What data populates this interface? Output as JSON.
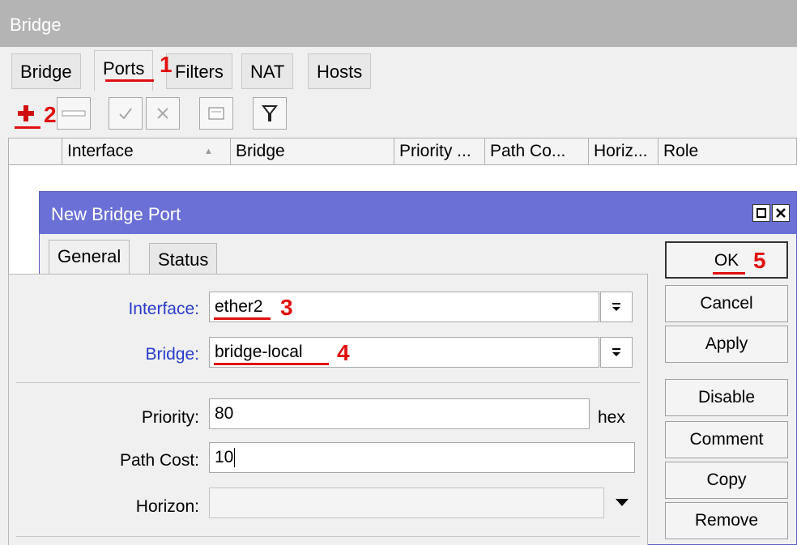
{
  "window": {
    "title": "Bridge"
  },
  "tabs": [
    "Bridge",
    "Ports",
    "Filters",
    "NAT",
    "Hosts"
  ],
  "toolbar": {
    "icons": [
      "add-icon",
      "remove-icon",
      "enable-check-icon",
      "disable-x-icon",
      "comment-icon",
      "filter-icon"
    ]
  },
  "table": {
    "columns": [
      "Interface",
      "Bridge",
      "Priority ...",
      "Path Co...",
      "Horiz...",
      "Role"
    ],
    "sort_marker": "▲"
  },
  "dialog": {
    "title": "New Bridge Port",
    "tabs": [
      "General",
      "Status"
    ],
    "fields": {
      "interface": {
        "label": "Interface:",
        "value": "ether2"
      },
      "bridge": {
        "label": "Bridge:",
        "value": "bridge-local"
      },
      "priority": {
        "label": "Priority:",
        "value": "80",
        "suffix": "hex"
      },
      "path_cost": {
        "label": "Path Cost:",
        "value": "10"
      },
      "horizon": {
        "label": "Horizon:",
        "value": ""
      }
    },
    "buttons": [
      "OK",
      "Cancel",
      "Apply",
      "Disable",
      "Comment",
      "Copy",
      "Remove"
    ]
  },
  "annotations": [
    "1",
    "2",
    "3",
    "4",
    "5"
  ],
  "colors": {
    "titlebar": "#b4b4b4",
    "dialog_titlebar": "#6b70d6",
    "annotation": "#e01010",
    "label_blue": "#2a3ccc"
  }
}
